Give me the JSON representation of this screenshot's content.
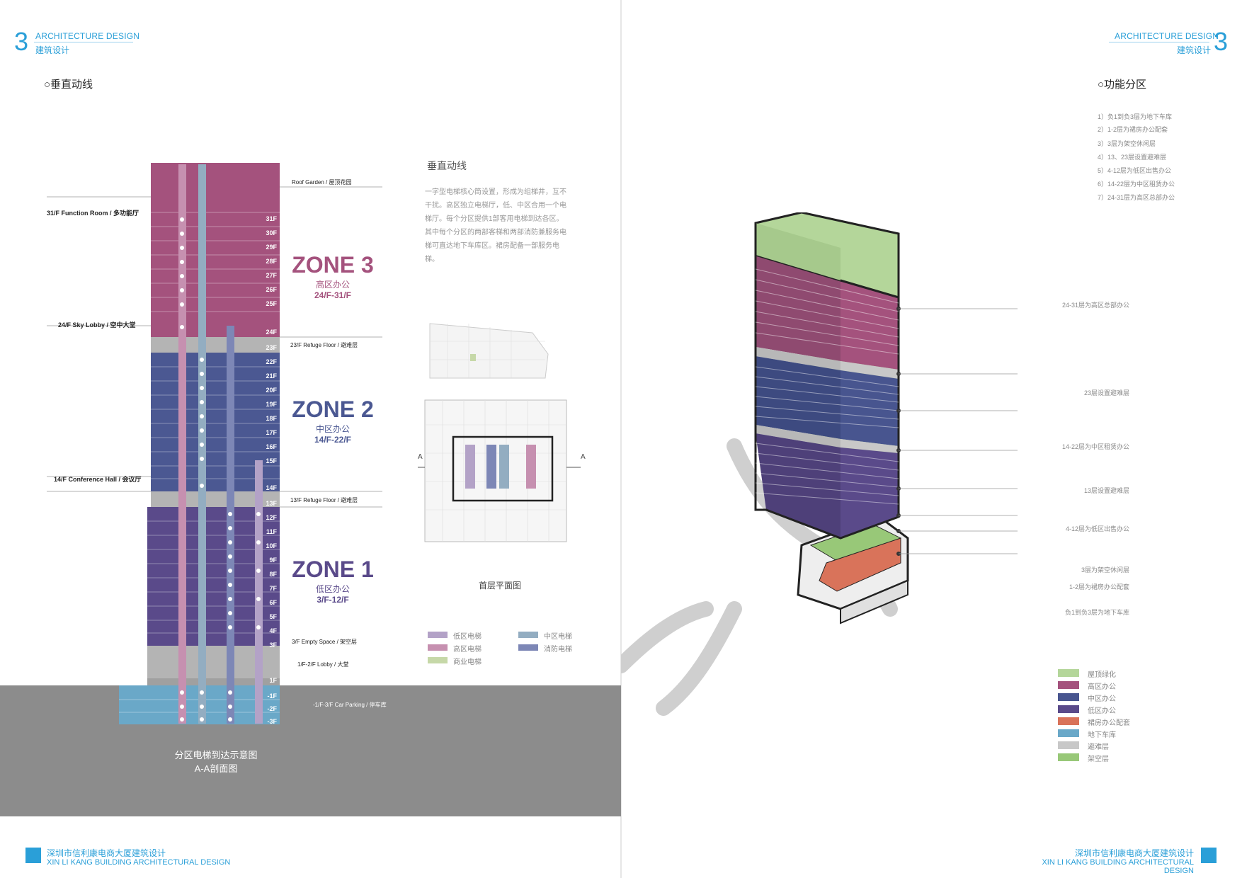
{
  "header": {
    "number": "3",
    "title_en": "ARCHITECTURE DESIGN",
    "title_cn": "建筑设计"
  },
  "left": {
    "section_title": "○垂直动线",
    "floors": [
      "31F",
      "30F",
      "29F",
      "28F",
      "27F",
      "26F",
      "25F",
      "24F",
      "23F",
      "22F",
      "21F",
      "20F",
      "19F",
      "18F",
      "17F",
      "16F",
      "15F",
      "14F",
      "13F",
      "12F",
      "11F",
      "10F",
      "9F",
      "8F",
      "7F",
      "6F",
      "5F",
      "4F",
      "3F",
      "1F",
      "-1F",
      "-2F",
      "-3F"
    ],
    "left_labels": {
      "function_room": "31/F Function Room / 多功能厅",
      "sky_lobby": "24/F Sky Lobby / 空中大堂",
      "conference": "14/F Conference Hall / 会议厅"
    },
    "right_labels": {
      "roof": "Roof Garden / 屋顶花园",
      "refuge23": "23/F Refuge Floor / 避难层",
      "refuge13": "13/F Refuge Floor / 避难层",
      "empty": "3/F Empty Space / 架空层",
      "lobby": "1/F-2/F Lobby / 大堂",
      "parking": "-1/F-3/F Car Parking / 停车库"
    },
    "zones": [
      {
        "name": "ZONE 3",
        "cn": "高区办公",
        "range": "24/F-31/F",
        "color": "#a4527d"
      },
      {
        "name": "ZONE 2",
        "cn": "中区办公",
        "range": "14/F-22/F",
        "color": "#4b5892"
      },
      {
        "name": "ZONE 1",
        "cn": "低区办公",
        "range": "3/F-12/F",
        "color": "#5a4a8a"
      }
    ],
    "caption_line1": "分区电梯到达示意图",
    "caption_line2": "A-A剖面图",
    "description_title": "垂直动线",
    "description": "一字型电梯核心筒设置，形成为组梯井，互不干扰。高区独立电梯厅，低、中区合用一个电梯厅。每个分区提供1部客用电梯到达各区。其中每个分区的两部客梯和两部消防兼服务电梯可直达地下车库区。裙房配备一部服务电梯。",
    "plan_caption": "首层平面图",
    "section_mark": "A",
    "legend": [
      {
        "label": "低区电梯",
        "color": "#b3a2c7"
      },
      {
        "label": "中区电梯",
        "color": "#93adc1"
      },
      {
        "label": "高区电梯",
        "color": "#c690b0"
      },
      {
        "label": "消防电梯",
        "color": "#7d87b6"
      },
      {
        "label": "商业电梯",
        "color": "#c6d8a8"
      }
    ]
  },
  "right": {
    "section_title": "○功能分区",
    "func_list": [
      "1）负1到负3层为地下车库",
      "2）1-2层为裙房办公配套",
      "3）3层为架空休闲层",
      "4）13、23层设置避难层",
      "5）4-12层为低区出售办公",
      "6）14-22层为中区租赁办公",
      "7）24-31层为高区总部办公"
    ],
    "callouts": [
      "24-31层为高区总部办公",
      "23层设置避难层",
      "14-22层为中区租赁办公",
      "13层设置避难层",
      "4-12层为低区出售办公",
      "3层为架空休闲层",
      "1-2层为裙房办公配套",
      "负1到负3层为地下车库"
    ],
    "legend": [
      {
        "label": "屋顶绿化",
        "color": "#b4d69a"
      },
      {
        "label": "高区办公",
        "color": "#a4527d"
      },
      {
        "label": "中区办公",
        "color": "#48558f"
      },
      {
        "label": "低区办公",
        "color": "#5a4a8a"
      },
      {
        "label": "裙房办公配套",
        "color": "#d9735a"
      },
      {
        "label": "地下车库",
        "color": "#6aa8c8"
      },
      {
        "label": "避难层",
        "color": "#c8c8c8"
      },
      {
        "label": "架空层",
        "color": "#98c878"
      }
    ]
  },
  "footer": {
    "title_cn": "深圳市信利康电商大厦建筑设计",
    "title_en": "XIN LI KANG BUILDING ARCHITECTURAL DESIGN"
  }
}
